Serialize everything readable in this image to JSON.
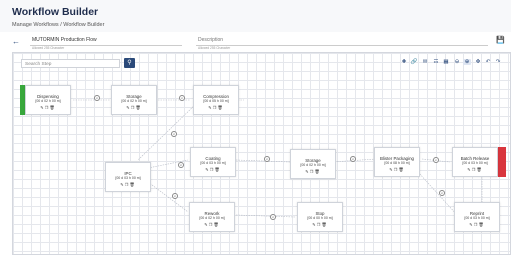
{
  "header": {
    "title": "Workflow Builder",
    "breadcrumb": "Manage Workflows / Workflow Builder"
  },
  "form": {
    "name_value": "MUTORMIN Production Flow",
    "name_note": "Allowed 255 Character",
    "description_placeholder": "Description",
    "description_note": "Allowed 255 Character"
  },
  "search": {
    "placeholder": "Search Step"
  },
  "toolbar": [
    "add-icon",
    "link-icon",
    "mail-icon",
    "layers-icon",
    "grid-icon",
    "zoom-out-icon",
    "zoom-in-icon",
    "move-icon",
    "undo-icon",
    "redo-icon"
  ],
  "nodes": [
    {
      "name": "Dispensing",
      "time": "[00 d 02 h 00 m]"
    },
    {
      "name": "Storage",
      "time": "[00 d 02 h 00 m]"
    },
    {
      "name": "Compression",
      "time": "[00 d 05 h 00 m]"
    },
    {
      "name": "IPC",
      "time": "[00 d 03 h 00 m]"
    },
    {
      "name": "Coating",
      "time": "[00 d 03 h 00 m]"
    },
    {
      "name": "Storage",
      "time": "[00 d 02 h 00 m]"
    },
    {
      "name": "Blister Packaging",
      "time": "[00 d 08 h 00 m]"
    },
    {
      "name": "Batch Release",
      "time": "[00 d 03 h 00 m]"
    },
    {
      "name": "Rework",
      "time": "[00 d 02 h 00 m]"
    },
    {
      "name": "Stop",
      "time": "[00 d 00 h 00 m]"
    },
    {
      "name": "Reprint",
      "time": "[00 d 03 h 00 m]"
    }
  ],
  "colors": {
    "start": "#38a83c",
    "end": "#d9363e",
    "brand": "#2b4a7a"
  }
}
